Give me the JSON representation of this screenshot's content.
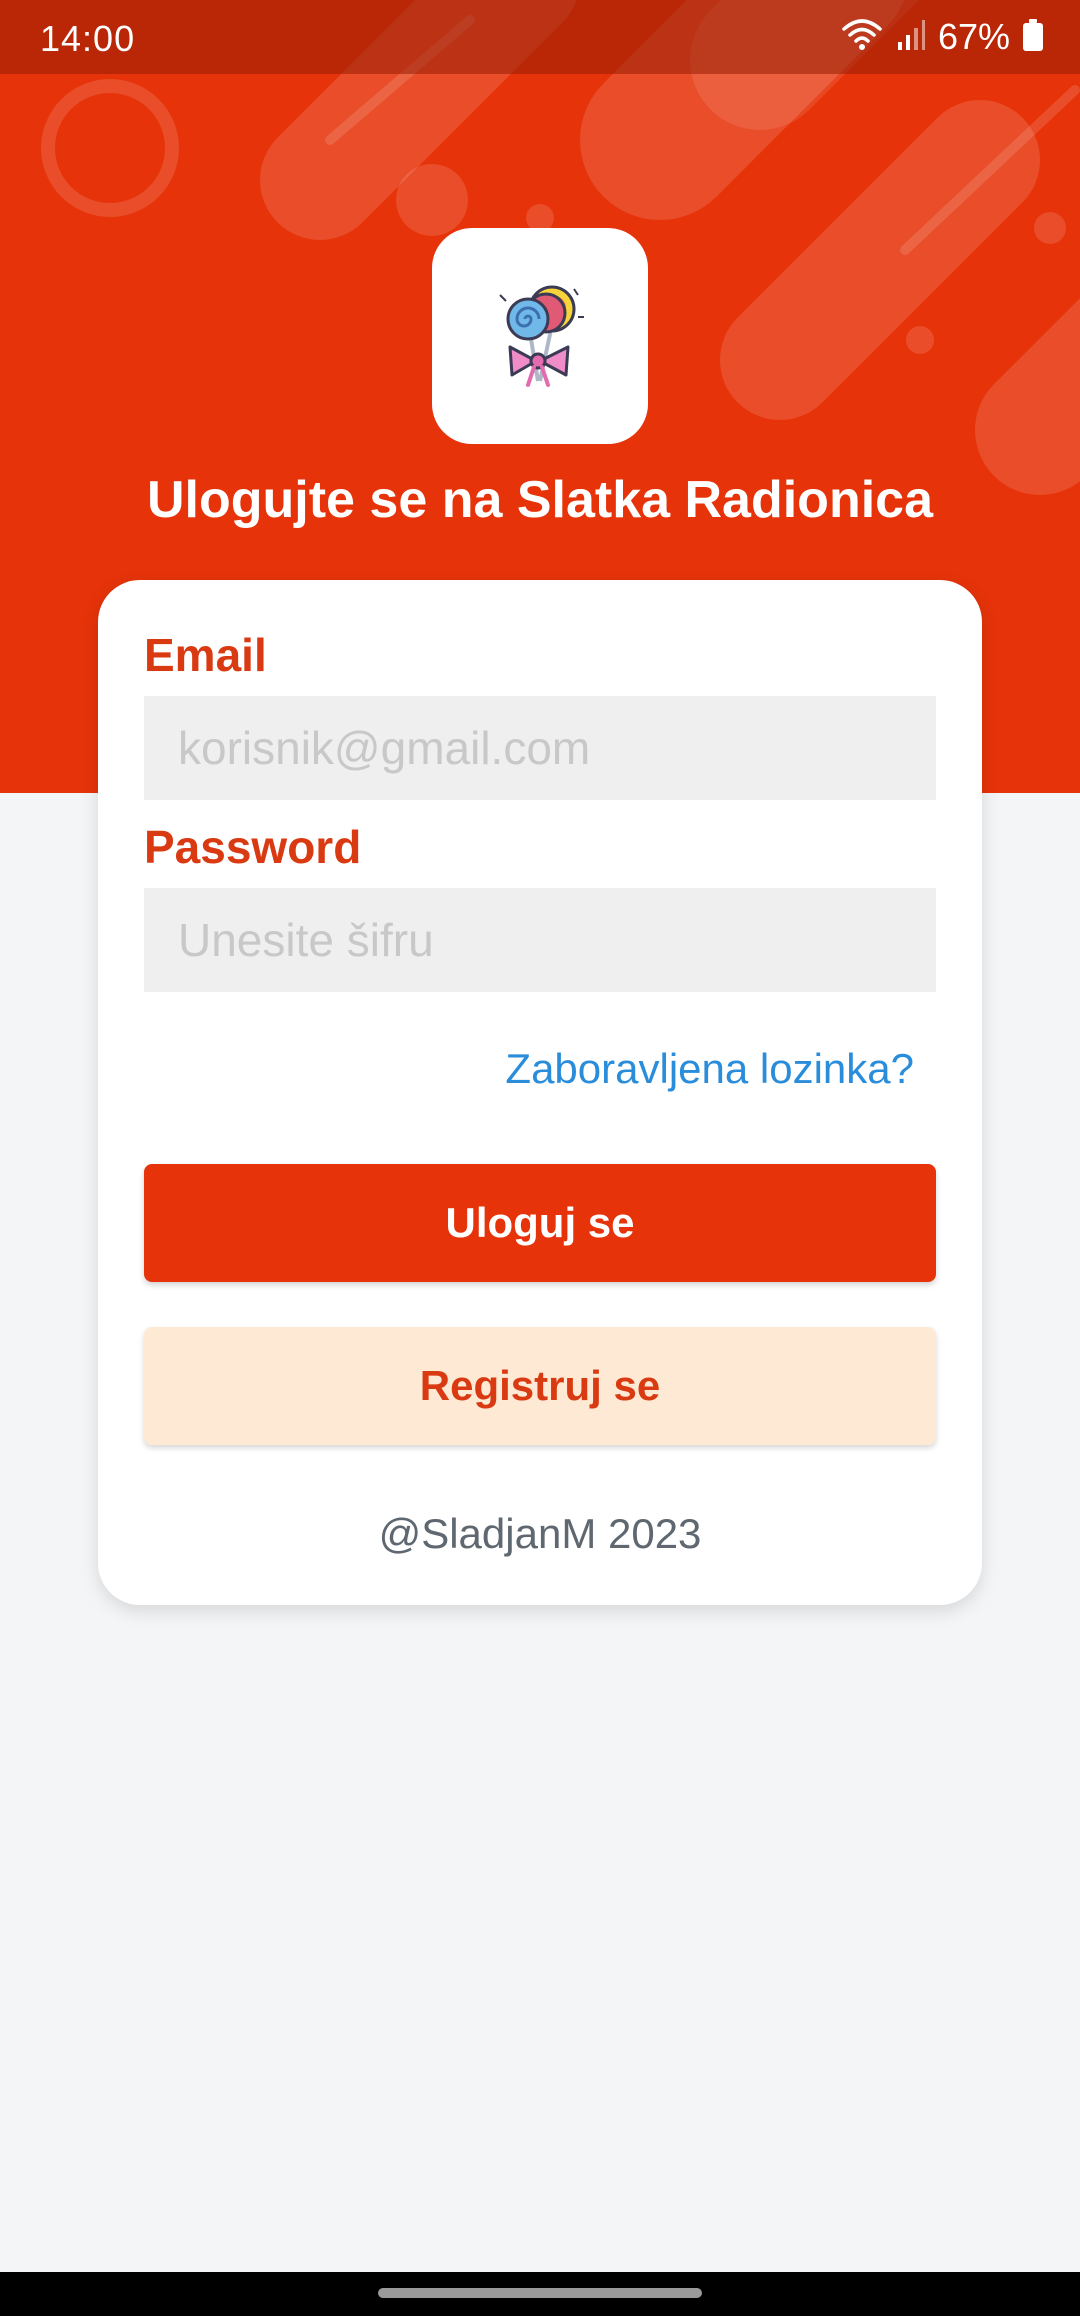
{
  "status_bar": {
    "time": "14:00",
    "battery": "67%",
    "icons": [
      "wifi-icon",
      "signal-icon",
      "battery-icon"
    ]
  },
  "header": {
    "logo_icon": "lollipop-candy-icon",
    "title": "Ulogujte se na Slatka Radionica"
  },
  "login_form": {
    "email_label": "Email",
    "email_value": "",
    "email_placeholder": "korisnik@gmail.com",
    "password_label": "Password",
    "password_value": "",
    "password_placeholder": "Unesite šifru",
    "forgot_password": "Zaboravljena lozinka?",
    "login_button": "Uloguj se",
    "register_button": "Registruj se",
    "footer": "@SladjanM 2023"
  },
  "colors": {
    "brand_red": "#e6330a",
    "label_red": "#d93a12",
    "link_blue": "#2a8ddb",
    "register_bg": "#fde9d4",
    "page_bg": "#f4f5f7"
  }
}
